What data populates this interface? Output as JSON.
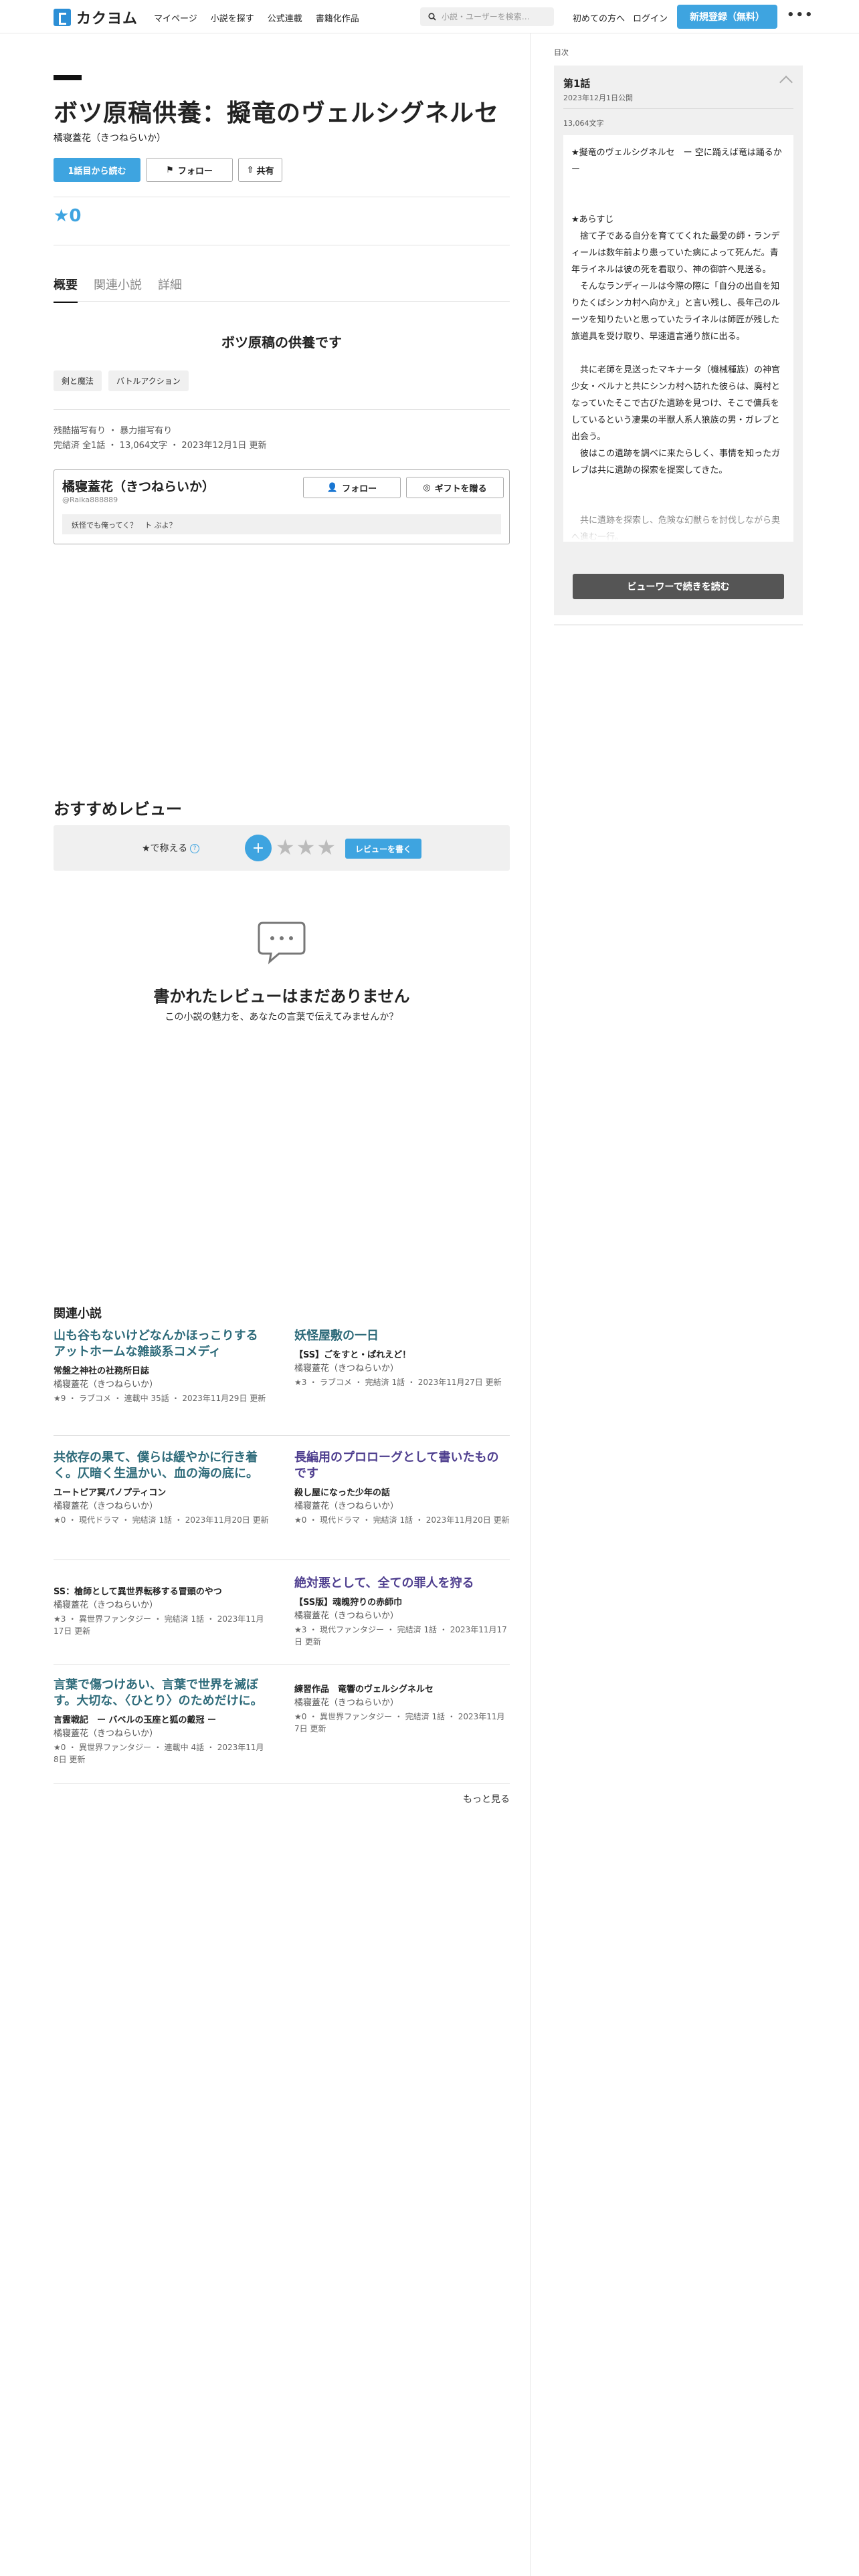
{
  "header": {
    "logo_text": "カクヨム",
    "nav": [
      "マイページ",
      "小説を探す",
      "公式連載",
      "書籍化作品"
    ],
    "search_placeholder": "小説・ユーザーを検索…",
    "first_time": "初めての方へ",
    "login": "ログイン",
    "signup": "新規登録（無料）",
    "more": "•••"
  },
  "work": {
    "title": "ボツ原稿供養：擬竜のヴェルシグネルセ",
    "author": "橘寝蓋花（きつねらいか）",
    "read_first": "1話目から読む",
    "follow": "フォロー",
    "share": "共有",
    "score": "0",
    "tabs": [
      "概要",
      "関連小説",
      "詳細"
    ],
    "catchphrase": "ボツ原稿の供養です",
    "tags": [
      "剣と魔法",
      "バトルアクション"
    ],
    "attributes": "残酷描写有り ・ 暴力描写有り",
    "status": "完結済 全1話 ・ 13,064文字 ・ 2023年12月1日 更新"
  },
  "author_box": {
    "name": "橘寝蓋花（きつねらいか）",
    "user_id": "@Raika888889",
    "follow": "フォロー",
    "gift": "ギフトを贈る",
    "bio": "妖怪でも俺ってく？　ト ぶよ？"
  },
  "reviews": {
    "title": "おすすめレビュー",
    "rate_label": "★で称える",
    "help": "?",
    "plus": "+",
    "stars": "★★★",
    "write": "レビューを書く",
    "empty_title": "書かれたレビューはまだありません",
    "empty_sub": "この小説の魅力を、あなたの言葉で伝えてみませんか？"
  },
  "related": {
    "title": "関連小説",
    "items": [
      {
        "title": "山も谷もないけどなんかほっこりするアットホームな雑談系コメディ",
        "sub": "常盤之神社の社務所日誌",
        "author": "橘寝蓋花（きつねらいか）",
        "meta": "★9 ・ ラブコメ ・ 連載中 35話 ・ 2023年11月29日 更新"
      },
      {
        "title": "妖怪屋敷の一日",
        "sub": "【SS】ごをすと・ぱれえど！",
        "author": "橘寝蓋花（きつねらいか）",
        "meta": "★3 ・ ラブコメ ・ 完結済 1話 ・ 2023年11月27日 更新"
      },
      {
        "title": "共依存の果て、僕らは緩やかに行き着く。仄暗く生温かい、血の海の底に。",
        "sub": "ユートピア冥パノプティコン",
        "author": "橘寝蓋花（きつねらいか）",
        "meta": "★0 ・ 現代ドラマ ・ 完結済 1話 ・ 2023年11月20日 更新"
      },
      {
        "title": "長編用のプロローグとして書いたものです",
        "sub": "殺し屋になった少年の話",
        "author": "橘寝蓋花（きつねらいか）",
        "meta": "★0 ・ 現代ドラマ ・ 完結済 1話 ・ 2023年11月20日 更新"
      },
      {
        "title": "",
        "sub": "SS：槍師として異世界転移する冒頭のやつ",
        "author": "橘寝蓋花（きつねらいか）",
        "meta": "★3 ・ 異世界ファンタジー ・ 完結済 1話 ・ 2023年11月17日 更新"
      },
      {
        "title": "絶対悪として、全ての罪人を狩る",
        "sub": "【SS版】魂魄狩りの赤師巾",
        "author": "橘寝蓋花（きつねらいか）",
        "meta": "★3 ・ 現代ファンタジー ・ 完結済 1話 ・ 2023年11月17日 更新"
      },
      {
        "title": "言葉で傷つけあい、言葉で世界を滅ぼす。大切な、〈ひとり〉のためだけに。",
        "sub": "言霊戦記　ー バベルの玉座と狐の戴冠 ー",
        "author": "橘寝蓋花（きつねらいか）",
        "meta": "★0 ・ 異世界ファンタジー ・ 連載中 4話 ・ 2023年11月8日 更新"
      },
      {
        "title": "",
        "sub": "練習作品　竜響のヴェルシグネルセ",
        "author": "橘寝蓋花（きつねらいか）",
        "meta": "★0 ・ 異世界ファンタジー ・ 完結済 1話 ・ 2023年11月7日 更新"
      }
    ],
    "more": "もっと見る"
  },
  "sidebar": {
    "toc": "目次",
    "episode_title": "第1話",
    "episode_date": "2023年12月1日公開",
    "char_count": "13,064文字",
    "body": "★擬竜のヴェルシグネルセ　ー 空に踊えば竜は踊るか ー\n\n\n★あらすじ\n　捨て子である自分を育ててくれた最愛の師・ランディールは数年前より患っていた病によって死んだ。青年ライネルは彼の死を看取り、神の御許へ見送る。\n　そんなランディールは今際の際に「自分の出自を知りたくばシンカ村へ向かえ」と言い残し、長年己のルーツを知りたいと思っていたライネルは師匠が残した旅道具を受け取り、早速遺言通り旅に出る。\n\n　共に老師を見送ったマキナータ（機械種族）の神官少女・ベルナと共にシンカ村へ訪れた彼らは、廃村となっていたそこで古びた遺跡を見つけ、そこで傭兵をしているという凄果の半獣人系人狼族の男・ガレブと出会う。\n　彼はこの遺跡を調べに来たらしく、事情を知ったガレブは共に遺跡の探索を提案してきた。\n\n\n　共に遺跡を探索し、危険な幻獣らを討伐しながら奥へ進む一行。\n……",
    "viewer_btn": "ビューワーで続きを読む"
  }
}
